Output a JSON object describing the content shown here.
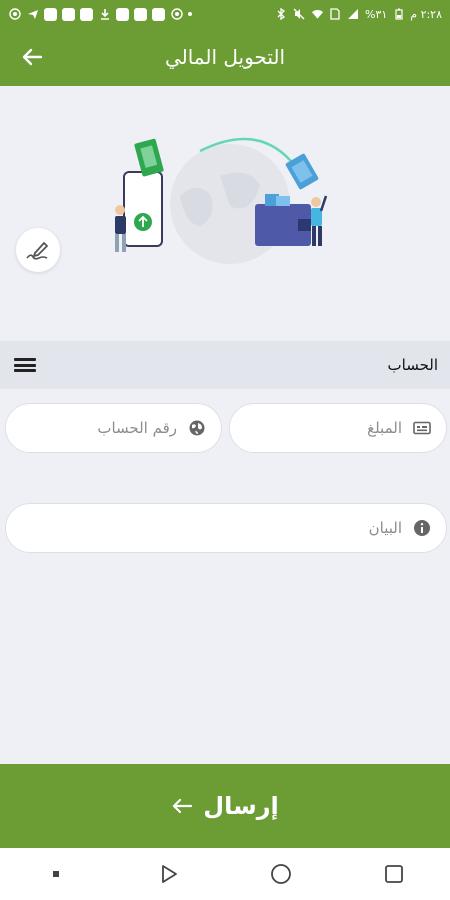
{
  "status_bar": {
    "time": "٢:٢٨ م",
    "battery": "%٣١",
    "left_icons": [
      "whatsapp-icon",
      "telegram-icon",
      "app-icon",
      "app-icon",
      "app-icon",
      "download-icon",
      "app-icon",
      "app-icon",
      "app-icon",
      "whatsapp-icon",
      "more-dot"
    ],
    "right_icons": [
      "bluetooth-icon",
      "mute-icon",
      "wifi-icon",
      "sim-icon",
      "signal-icon",
      "battery-icon"
    ]
  },
  "header": {
    "title": "التحويل المالي",
    "back_icon": "arrow-left-icon"
  },
  "colors": {
    "primary": "#6c9d35",
    "background": "#eef0f5",
    "section_bg": "#e2e5ec",
    "field_bg": "#ffffff",
    "accent_green": "#2ea84f",
    "wallet_blue": "#4e5aa8"
  },
  "section": {
    "account_label": "الحساب",
    "menu_icon": "hamburger-menu-icon"
  },
  "form": {
    "amount": {
      "placeholder": "المبلغ",
      "value": "",
      "icon": "card-icon"
    },
    "account_number": {
      "placeholder": "رقم الحساب",
      "value": "",
      "icon": "globe-icon"
    },
    "statement": {
      "placeholder": "البيان",
      "value": "",
      "icon": "info-icon"
    }
  },
  "actions": {
    "send_label": "إرسال",
    "send_icon": "arrow-left-icon"
  },
  "edit_icon": "signature-pen-icon",
  "nav": {
    "buttons": [
      "dot-icon",
      "back-triangle-icon",
      "home-circle-icon",
      "recents-square-icon"
    ]
  }
}
